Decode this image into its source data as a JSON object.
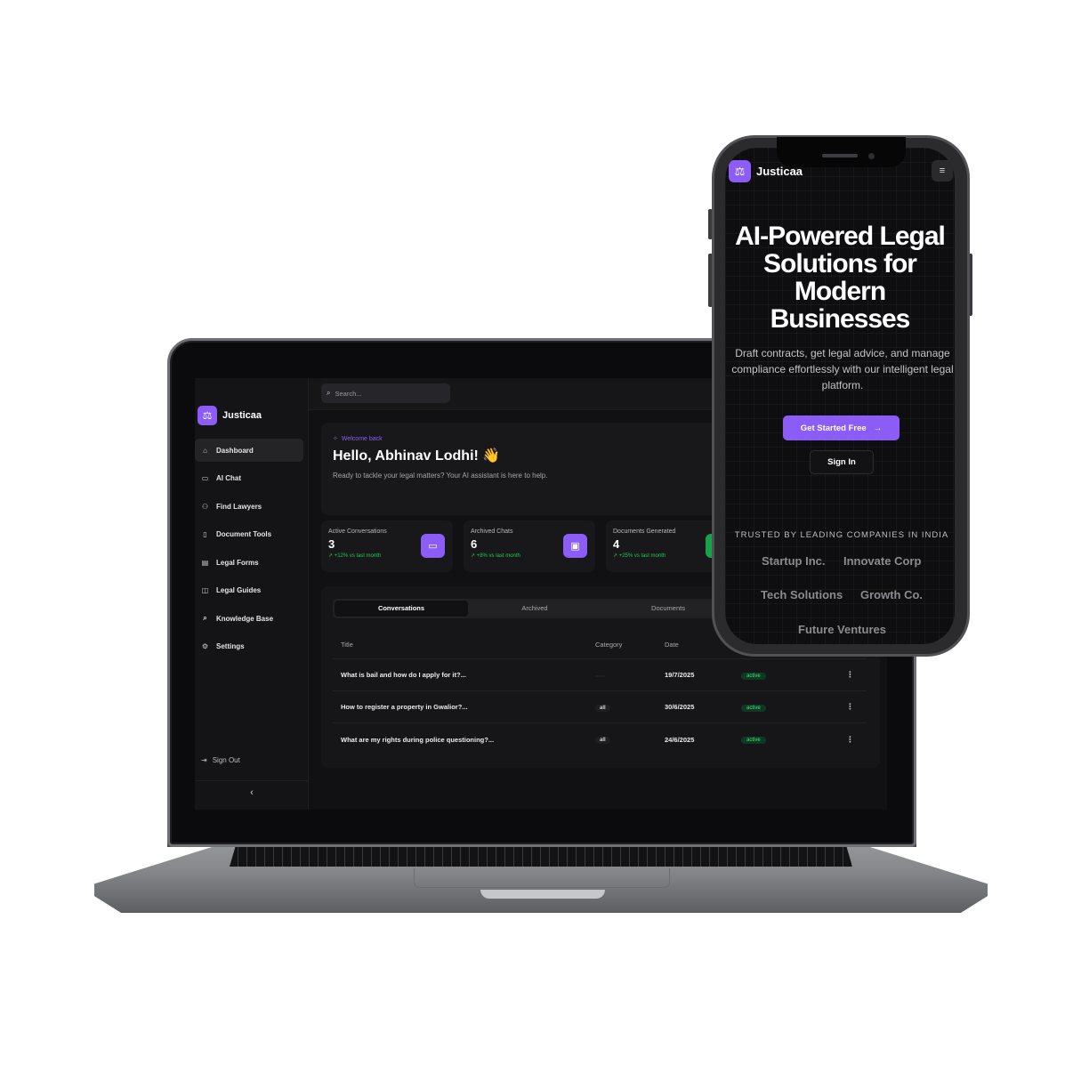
{
  "laptop": {
    "brand": {
      "name": "Justicaa",
      "logo_icon": "scales-icon"
    },
    "sidebar": {
      "items": [
        {
          "label": "Dashboard",
          "icon": "home-icon",
          "glyph": "⌂",
          "active": true
        },
        {
          "label": "AI Chat",
          "icon": "chat-icon",
          "glyph": "▭",
          "active": false
        },
        {
          "label": "Find Lawyers",
          "icon": "users-icon",
          "glyph": "⚇",
          "active": false
        },
        {
          "label": "Document Tools",
          "icon": "document-icon",
          "glyph": "▯",
          "active": false
        },
        {
          "label": "Legal Forms",
          "icon": "form-icon",
          "glyph": "▤",
          "active": false
        },
        {
          "label": "Legal Guides",
          "icon": "book-icon",
          "glyph": "◫",
          "active": false
        },
        {
          "label": "Knowledge Base",
          "icon": "search-icon",
          "glyph": "⌕",
          "active": false
        },
        {
          "label": "Settings",
          "icon": "gear-icon",
          "glyph": "⚙",
          "active": false
        }
      ],
      "sign_out": "Sign Out",
      "collapse_glyph": "‹"
    },
    "search": {
      "placeholder": "Search..."
    },
    "welcome": {
      "tag": "Welcome back",
      "greeting": "Hello, Abhinav Lodhi! 👋",
      "subtitle": "Ready to tackle your legal matters? Your AI assistant is here to help."
    },
    "stats": [
      {
        "label": "Active Conversations",
        "value": "3",
        "change": "↗ +12% vs last month",
        "icon": "chat-icon",
        "glyph": "▭",
        "color": "#8b5cf6"
      },
      {
        "label": "Archived Chats",
        "value": "6",
        "change": "↗ +8% vs last month",
        "icon": "archive-icon",
        "glyph": "▣",
        "color": "#8b5cf6"
      },
      {
        "label": "Documents Generated",
        "value": "4",
        "change": "↗ +25% vs last month",
        "icon": "document-icon",
        "glyph": "▯",
        "color": "#16a34a"
      }
    ],
    "tabs": [
      {
        "label": "Conversations",
        "active": true
      },
      {
        "label": "Archived",
        "active": false
      },
      {
        "label": "Documents",
        "active": false
      }
    ],
    "table": {
      "headers": [
        "Title",
        "Category",
        "Date",
        ""
      ],
      "rows": [
        {
          "title": "What is bail and how do I apply for it?...",
          "category": "",
          "date": "19/7/2025",
          "status": "active"
        },
        {
          "title": "How to register a property in Gwalior?...",
          "category": "all",
          "date": "30/6/2025",
          "status": "active"
        },
        {
          "title": "What are my rights during police questioning?...",
          "category": "all",
          "date": "24/6/2025",
          "status": "active"
        }
      ]
    }
  },
  "phone": {
    "brand": "Justicaa",
    "menu_icon": "hamburger-icon",
    "hero_lines": [
      "AI-Powered Legal",
      "Solutions for",
      "Modern",
      "Businesses"
    ],
    "description": "Draft contracts, get legal advice, and manage compliance effortlessly with our intelligent legal platform.",
    "cta": "Get Started Free",
    "sign_in": "Sign In",
    "trusted_label": "TRUSTED BY LEADING COMPANIES IN INDIA",
    "companies": [
      "Startup Inc.",
      "Innovate Corp",
      "Tech Solutions",
      "Growth Co.",
      "Future Ventures"
    ]
  },
  "colors": {
    "accent": "#8b5cf6",
    "success": "#22c55e"
  }
}
